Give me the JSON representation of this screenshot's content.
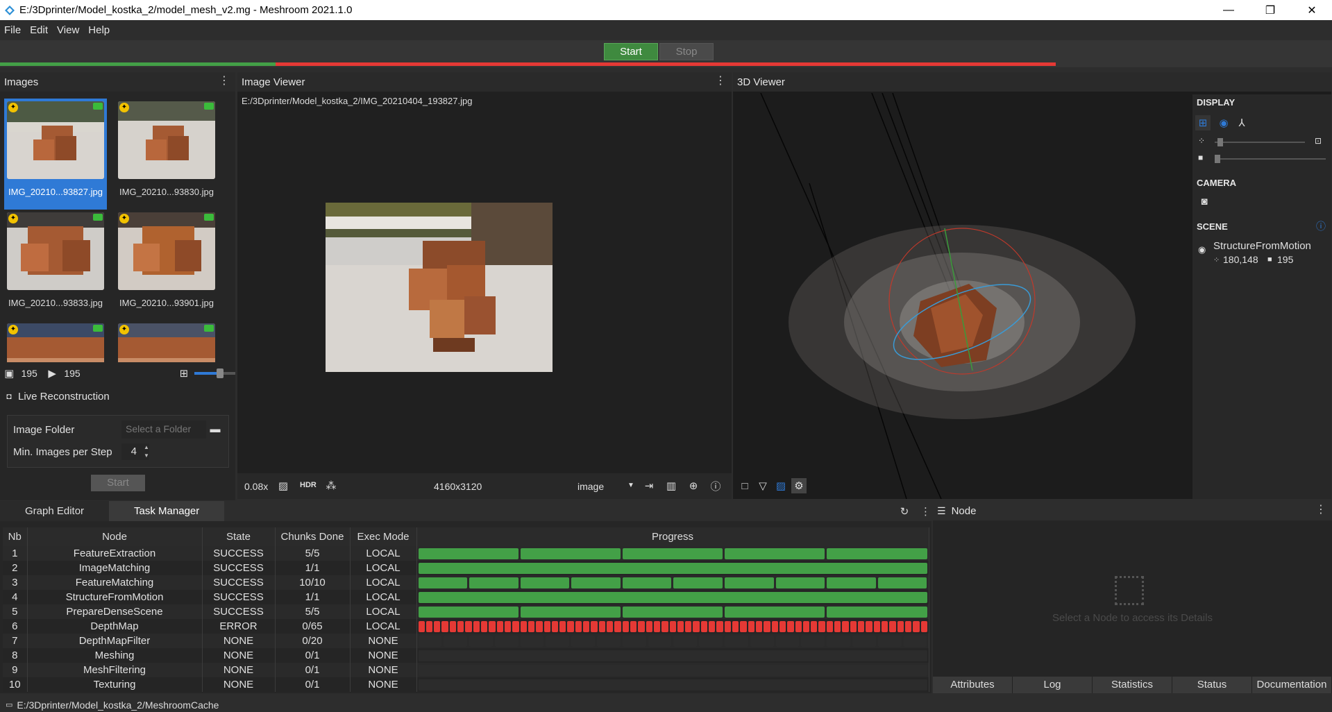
{
  "window": {
    "title": "E:/3Dprinter/Model_kostka_2/model_mesh_v2.mg - Meshroom 2021.1.0",
    "minimize": "—",
    "maximize": "❐",
    "close": "✕"
  },
  "menu": {
    "file": "File",
    "edit": "Edit",
    "view": "View",
    "help": "Help"
  },
  "toolbar": {
    "start": "Start",
    "stop": "Stop"
  },
  "colors": {
    "success": "#43a047",
    "error": "#e53935",
    "accent": "#2f7ad6"
  },
  "images": {
    "title": "Images",
    "items": [
      {
        "label": "IMG_20210...93827.jpg",
        "selected": true
      },
      {
        "label": "IMG_20210...93830.jpg"
      },
      {
        "label": "IMG_20210...93833.jpg"
      },
      {
        "label": "IMG_20210...93901.jpg"
      }
    ],
    "image_count": "195",
    "camera_count": "195"
  },
  "live": {
    "title": "Live Reconstruction",
    "folder_label": "Image Folder",
    "folder_placeholder": "Select a Folder",
    "min_label": "Min. Images per Step",
    "min_value": "4",
    "start": "Start"
  },
  "image_viewer": {
    "title": "Image Viewer",
    "path": "E:/3Dprinter/Model_kostka_2/IMG_20210404_193827.jpg",
    "zoom": "0.08x",
    "hdr": "HDR",
    "resolution": "4160x3120",
    "mode": "image"
  },
  "viewer3d": {
    "title": "3D Viewer",
    "display": "DISPLAY",
    "camera": "CAMERA",
    "scene": "SCENE",
    "scene_item": "StructureFromMotion",
    "points": "180,148",
    "cameras": "195"
  },
  "tabs": {
    "graph": "Graph Editor",
    "task": "Task Manager"
  },
  "task_manager": {
    "headers": [
      "Nb",
      "Node",
      "State",
      "Chunks Done",
      "Exec Mode",
      "Progress"
    ],
    "rows": [
      {
        "nb": "1",
        "node": "FeatureExtraction",
        "state": "SUCCESS",
        "chunks": "5/5",
        "mode": "LOCAL",
        "total": 5,
        "done": 5,
        "status": "success"
      },
      {
        "nb": "2",
        "node": "ImageMatching",
        "state": "SUCCESS",
        "chunks": "1/1",
        "mode": "LOCAL",
        "total": 1,
        "done": 1,
        "status": "success"
      },
      {
        "nb": "3",
        "node": "FeatureMatching",
        "state": "SUCCESS",
        "chunks": "10/10",
        "mode": "LOCAL",
        "total": 10,
        "done": 10,
        "status": "success"
      },
      {
        "nb": "4",
        "node": "StructureFromMotion",
        "state": "SUCCESS",
        "chunks": "1/1",
        "mode": "LOCAL",
        "total": 1,
        "done": 1,
        "status": "success"
      },
      {
        "nb": "5",
        "node": "PrepareDenseScene",
        "state": "SUCCESS",
        "chunks": "5/5",
        "mode": "LOCAL",
        "total": 5,
        "done": 5,
        "status": "success"
      },
      {
        "nb": "6",
        "node": "DepthMap",
        "state": "ERROR",
        "chunks": "0/65",
        "mode": "LOCAL",
        "total": 65,
        "done": 0,
        "status": "error"
      },
      {
        "nb": "7",
        "node": "DepthMapFilter",
        "state": "NONE",
        "chunks": "0/20",
        "mode": "NONE",
        "total": 20,
        "done": 0,
        "status": "none"
      },
      {
        "nb": "8",
        "node": "Meshing",
        "state": "NONE",
        "chunks": "0/1",
        "mode": "NONE",
        "total": 1,
        "done": 0,
        "status": "none"
      },
      {
        "nb": "9",
        "node": "MeshFiltering",
        "state": "NONE",
        "chunks": "0/1",
        "mode": "NONE",
        "total": 1,
        "done": 0,
        "status": "none"
      },
      {
        "nb": "10",
        "node": "Texturing",
        "state": "NONE",
        "chunks": "0/1",
        "mode": "NONE",
        "total": 1,
        "done": 0,
        "status": "none"
      }
    ]
  },
  "node_panel": {
    "title": "Node",
    "placeholder": "Select a Node to access its Details",
    "tabs": [
      "Attributes",
      "Log",
      "Statistics",
      "Status",
      "Documentation"
    ]
  },
  "status_bar": {
    "path": "E:/3Dprinter/Model_kostka_2/MeshroomCache"
  }
}
